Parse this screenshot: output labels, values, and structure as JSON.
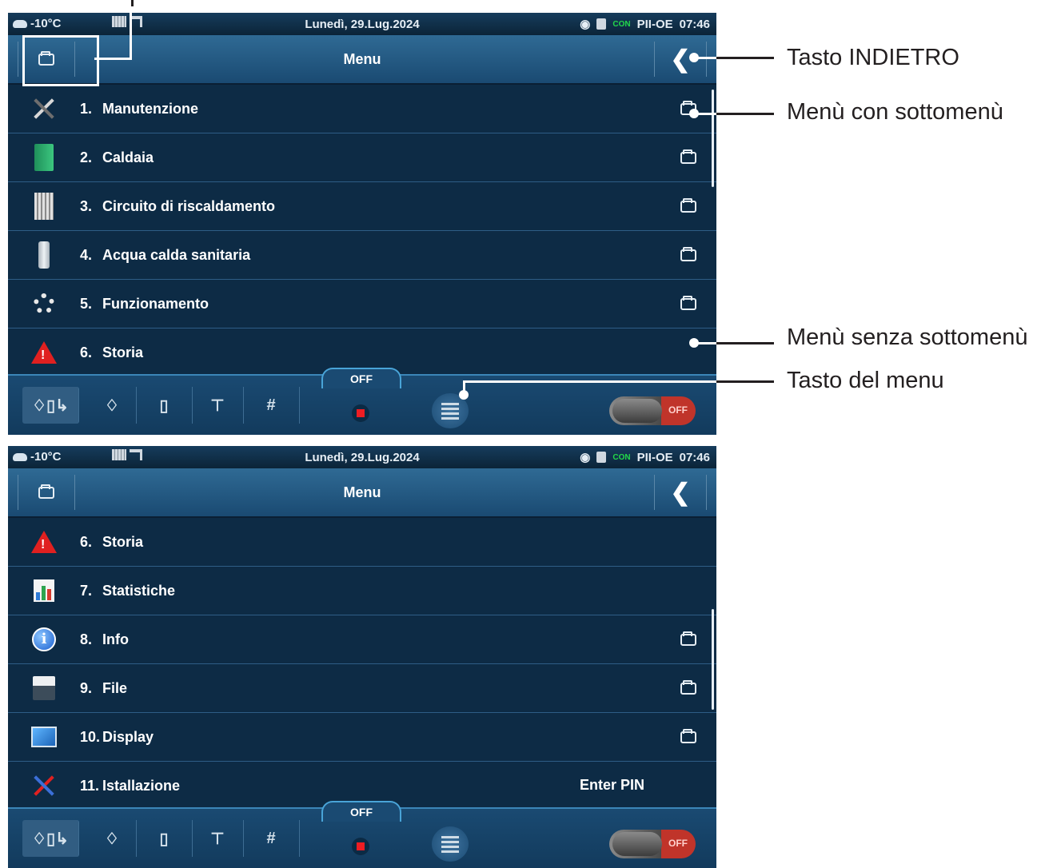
{
  "status": {
    "temperature": "-10°C",
    "date": "Lunedì, 29.Lug.2024",
    "con_label": "CON",
    "device": "PII-OE",
    "time": "07:46"
  },
  "header": {
    "title": "Menu",
    "back_glyph": "❮"
  },
  "screens": [
    {
      "rows": [
        {
          "num": "1.",
          "label": "Manutenzione",
          "icon": "tools-icon",
          "submenu": true
        },
        {
          "num": "2.",
          "label": "Caldaia",
          "icon": "boiler-icon",
          "submenu": true
        },
        {
          "num": "3.",
          "label": "Circuito di riscaldamento",
          "icon": "radiator-icon",
          "submenu": true
        },
        {
          "num": "4.",
          "label": "Acqua calda sanitaria",
          "icon": "water-tank-icon",
          "submenu": true
        },
        {
          "num": "5.",
          "label": "Funzionamento",
          "icon": "gear-icon",
          "submenu": true
        },
        {
          "num": "6.",
          "label": "Storia",
          "icon": "warning-icon",
          "submenu": false
        }
      ]
    },
    {
      "rows": [
        {
          "num": "6.",
          "label": "Storia",
          "icon": "warning-icon",
          "submenu": false
        },
        {
          "num": "7.",
          "label": "Statistiche",
          "icon": "statistics-icon",
          "submenu": false
        },
        {
          "num": "8.",
          "label": "Info",
          "icon": "info-icon",
          "submenu": true
        },
        {
          "num": "9.",
          "label": "File",
          "icon": "file-icon",
          "submenu": true
        },
        {
          "num": "10.",
          "label": "Display",
          "icon": "display-icon",
          "submenu": true
        },
        {
          "num": "11.",
          "label": "Istallazione",
          "icon": "installation-icon",
          "submenu": false,
          "right_text": "Enter PIN"
        }
      ]
    }
  ],
  "bottom": {
    "off_label": "OFF",
    "toggle_label": "OFF"
  },
  "annotations": {
    "back_key": "Tasto INDIETRO",
    "with_submenu": "Menù con sottomenù",
    "without_submenu": "Menù senza sottomenù",
    "menu_key": "Tasto del menu"
  },
  "colors": {
    "screen_bg": "#0d2b45",
    "header": "#2f6a94",
    "accent": "#49a4d8",
    "stop": "#ee1d23",
    "con": "#22d84a"
  }
}
